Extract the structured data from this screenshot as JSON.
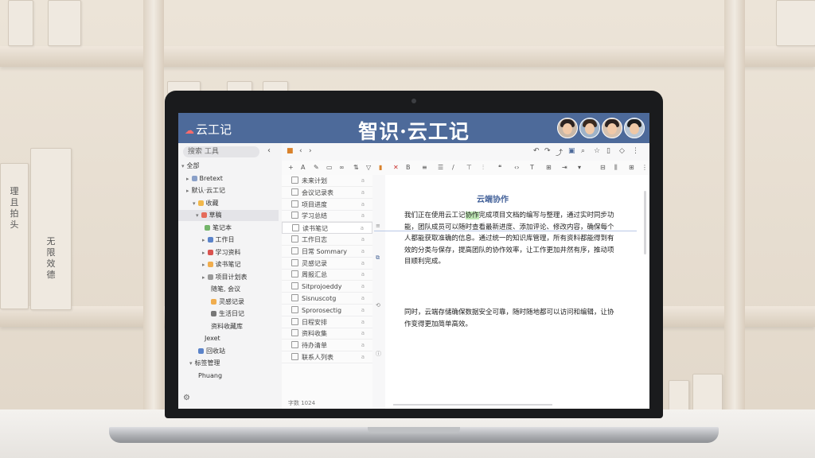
{
  "window": {
    "app_name": "云工记",
    "banner_title": "智识·云工记",
    "logo_icon": "cloud-logo-icon",
    "accent": "#4d6a9a"
  },
  "shelf_books": [
    "理\n且\n拍\n头",
    "无\n限\n效\n德"
  ],
  "sidebar": {
    "search_placeholder": "搜索  工具",
    "collapse_icon": "‹",
    "tree": [
      {
        "caret": "▾",
        "label": "全部",
        "color": ""
      },
      {
        "caret": "▸",
        "label": "Bretext",
        "color": "#8aa0c8"
      },
      {
        "caret": "▸",
        "label": "默认·云工记",
        "color": ""
      },
      {
        "caret": "▾",
        "label": "收藏",
        "color": "#f2b84b"
      },
      {
        "caret": "▾",
        "label": "草稿",
        "color": "#e56b5a"
      },
      {
        "caret": "",
        "label": "笔记本",
        "color": "#74b56a"
      },
      {
        "caret": "▸",
        "label": "工作日",
        "color": "#5b83c9"
      },
      {
        "caret": "▸",
        "label": "学习资料",
        "color": "#d9534f"
      },
      {
        "caret": "▸",
        "label": "读书笔记",
        "color": "#f0ad4e"
      },
      {
        "caret": "▸",
        "label": "项目计划表",
        "color": "#999999"
      },
      {
        "caret": "",
        "label": "随笔, 会议",
        "color": ""
      },
      {
        "caret": "",
        "label": "灵感记录",
        "color": "#f0ad4e"
      },
      {
        "caret": "",
        "label": "生活日记",
        "color": "#777777"
      },
      {
        "caret": "",
        "label": "资料收藏库",
        "color": ""
      },
      {
        "caret": "",
        "label": "Jexet",
        "color": ""
      },
      {
        "caret": "",
        "label": "回收站",
        "color": "#5b83c9"
      },
      {
        "caret": "▾",
        "label": "标签管理",
        "color": ""
      },
      {
        "caret": "",
        "label": "Phuang",
        "color": ""
      }
    ]
  },
  "notes": [
    {
      "label": "未来计划",
      "meta": "a"
    },
    {
      "label": "会议记录表",
      "meta": "a"
    },
    {
      "label": "项目进度",
      "meta": "a"
    },
    {
      "label": "学习总结",
      "meta": "a"
    },
    {
      "label": "读书笔记",
      "meta": "a"
    },
    {
      "label": "工作日志",
      "meta": "a"
    },
    {
      "label": "日常 Sommary",
      "meta": "a"
    },
    {
      "label": "灵感记录",
      "meta": "a"
    },
    {
      "label": "周报汇总",
      "meta": "a"
    },
    {
      "label": "Sitprojoeddy",
      "meta": "a"
    },
    {
      "label": "Sisnuscotg",
      "meta": "a"
    },
    {
      "label": "Sprorosectig",
      "meta": "a"
    },
    {
      "label": "日程安排",
      "meta": "a"
    },
    {
      "label": "资料收集",
      "meta": "a"
    },
    {
      "label": "待办清单",
      "meta": "a"
    },
    {
      "label": "联系人列表",
      "meta": "a"
    }
  ],
  "editor": {
    "doc_title": "云端协作",
    "para1_a": "我们正在使用云工记",
    "para1_hl": "协作",
    "para1_b": "完成项目文档的编写与整理，通过实时同步功能，团队成员可以随时查看最新进度、添加评论、修改内容，确保每个人都能获取准确的信息。通过统一的知识库管理，所有资料都能得到有效的分类与保存，提高团队的协作效率，让工作更加井然有序，推动项目顺利完成。",
    "para2": "同时，云端存储确保数据安全可靠，随时随地都可以访问和编辑，让协作变得更加简单高效。",
    "status": "字数 1024"
  }
}
